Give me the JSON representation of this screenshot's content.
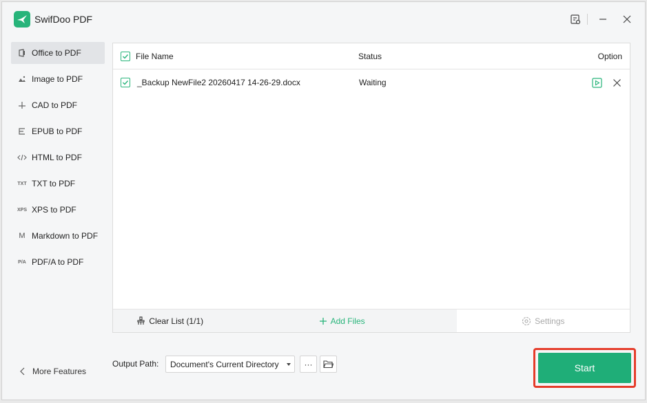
{
  "app": {
    "title": "SwifDoo PDF"
  },
  "sidebar": {
    "items": [
      {
        "label": "Office to PDF",
        "icon": "office-icon",
        "active": true
      },
      {
        "label": "Image to PDF",
        "icon": "image-icon",
        "active": false
      },
      {
        "label": "CAD to PDF",
        "icon": "cad-icon",
        "active": false
      },
      {
        "label": "EPUB to PDF",
        "icon": "epub-icon",
        "active": false
      },
      {
        "label": "HTML to PDF",
        "icon": "html-icon",
        "active": false
      },
      {
        "label": "TXT to PDF",
        "icon": "txt-icon",
        "icon_text": "TXT",
        "active": false
      },
      {
        "label": "XPS to PDF",
        "icon": "xps-icon",
        "icon_text": "XPS",
        "active": false
      },
      {
        "label": "Markdown to PDF",
        "icon": "markdown-icon",
        "icon_text": "M",
        "active": false
      },
      {
        "label": "PDF/A to PDF",
        "icon": "pdfa-icon",
        "icon_text": "P/A",
        "active": false
      }
    ],
    "more_features": "More Features"
  },
  "table": {
    "headers": {
      "file_name": "File Name",
      "status": "Status",
      "option": "Option"
    },
    "rows": [
      {
        "file_name": "_Backup NewFile2 20260417 14-26-29.docx",
        "status": "Waiting",
        "checked": true
      }
    ]
  },
  "footer": {
    "clear_list": "Clear List (1/1)",
    "add_files": "Add Files",
    "settings": "Settings"
  },
  "output": {
    "label": "Output Path:",
    "path": "Document's Current Directory",
    "more": "···"
  },
  "start_label": "Start",
  "colors": {
    "accent": "#1fae78",
    "highlight": "#e53c2a"
  }
}
